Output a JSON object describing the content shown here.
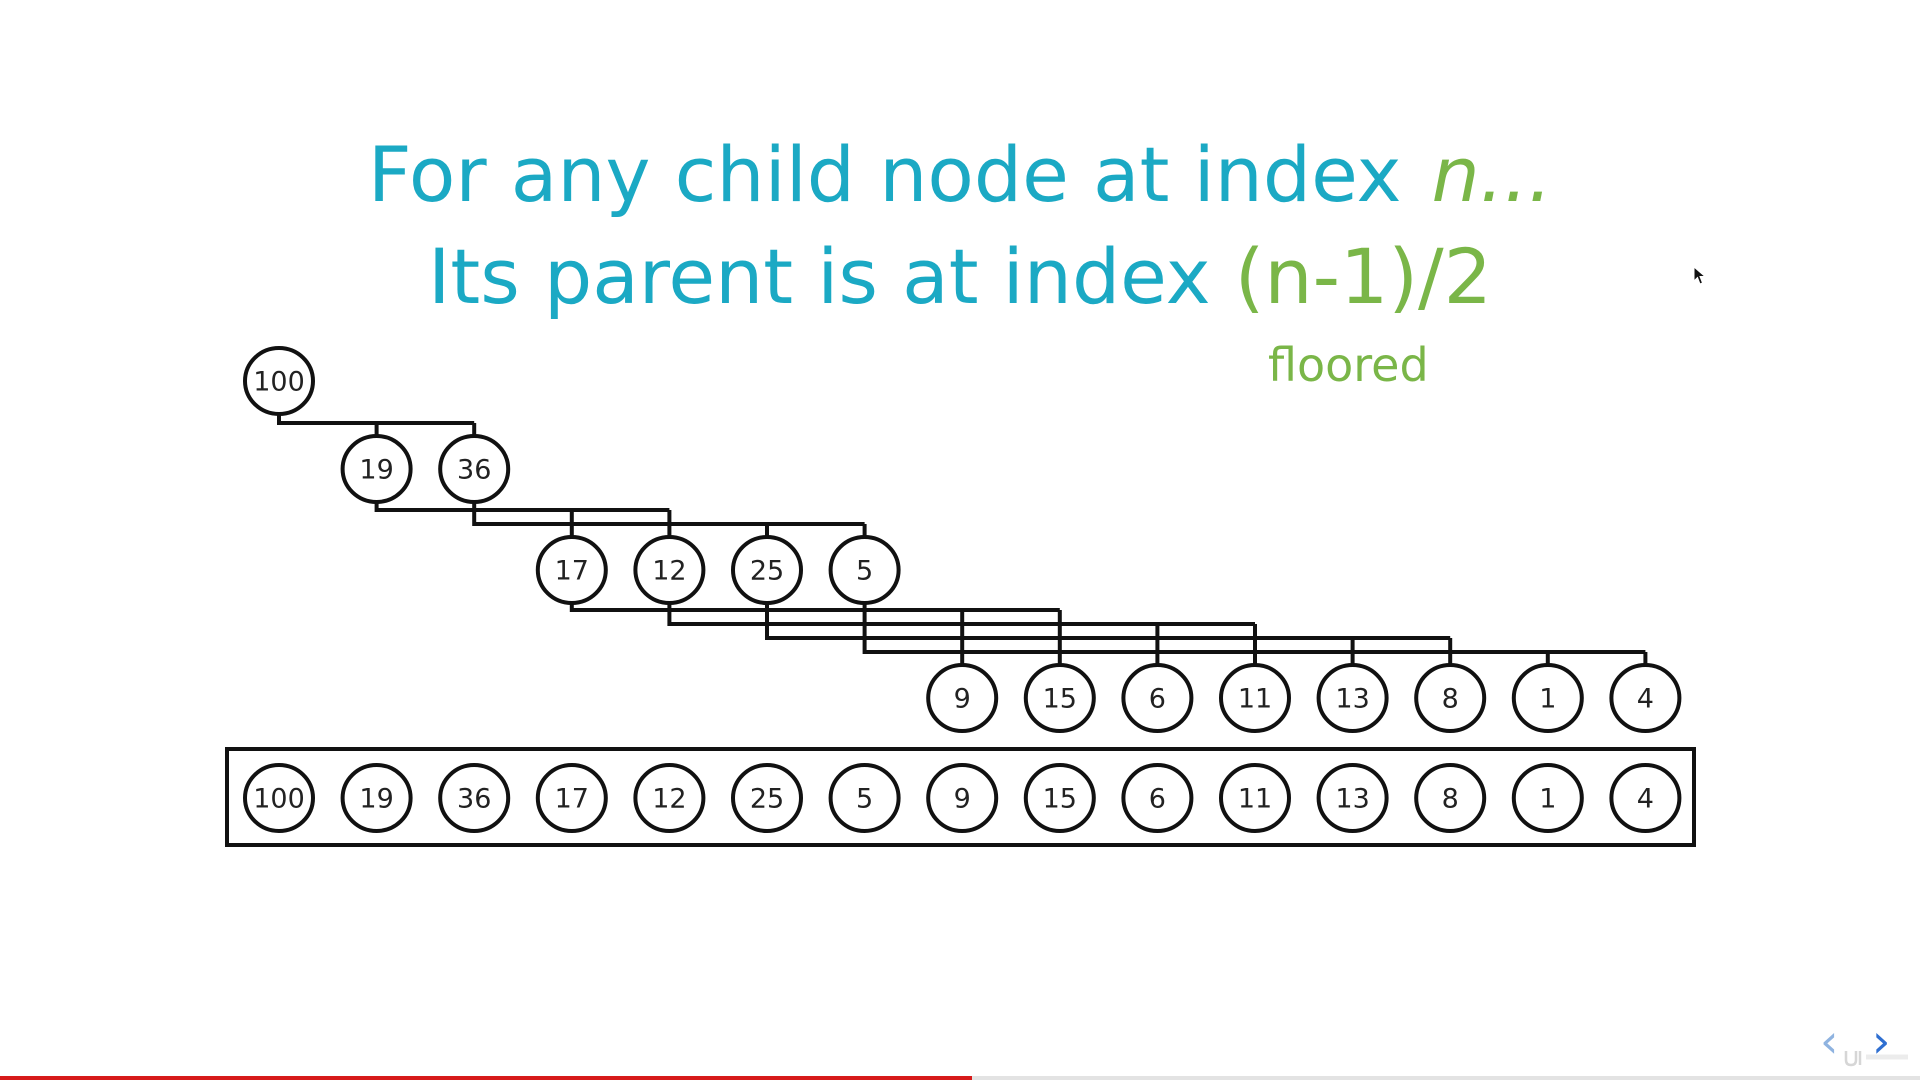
{
  "heading": {
    "line1_text": "For any child node at index",
    "line1_var": "n...",
    "line2_text": "Its parent is at index",
    "line2_formula": "(n-1)/2",
    "note": "floored"
  },
  "heap": {
    "nodes": [
      "100",
      "19",
      "36",
      "17",
      "12",
      "25",
      "5",
      "9",
      "15",
      "6",
      "11",
      "13",
      "8",
      "1",
      "4"
    ],
    "array": [
      "100",
      "19",
      "36",
      "17",
      "12",
      "25",
      "5",
      "9",
      "15",
      "6",
      "11",
      "13",
      "8",
      "1",
      "4"
    ]
  },
  "icons": {
    "prev": "chevron-left-icon",
    "next": "chevron-right-icon",
    "cursor": "mouse-cursor-icon"
  },
  "glyphs": {
    "prev": "‹",
    "next": "›"
  },
  "colors": {
    "headline": "#1ba9c4",
    "accent": "#7ab648",
    "nav_prev": "#8fb3e0",
    "nav_next": "#2f6fd1",
    "progress": "#d71a1a"
  },
  "progress": {
    "fraction": 0.506
  }
}
